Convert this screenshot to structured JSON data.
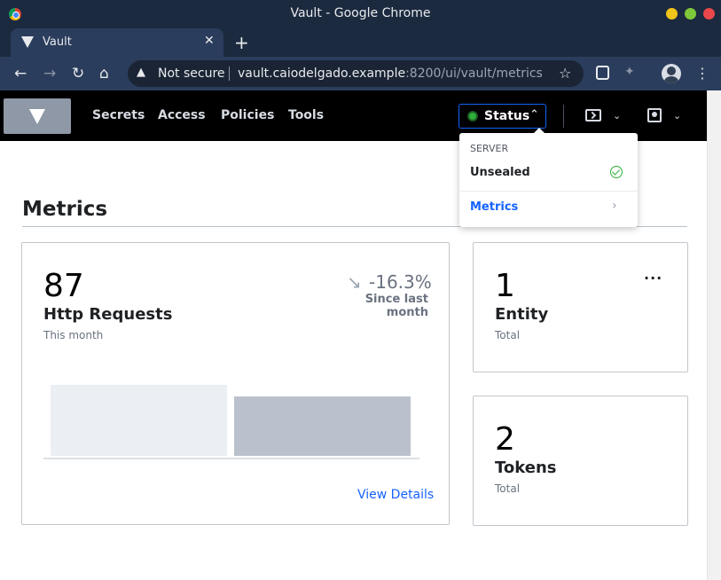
{
  "window": {
    "title": "Vault - Google Chrome"
  },
  "tab": {
    "title": "Vault",
    "close": "✕",
    "new_tab": "+"
  },
  "toolbar": {
    "security_text": "Not secure",
    "url_host": "vault.caiodelgado.example",
    "url_path": ":8200/ui/vault/metrics",
    "icons": [
      "back-icon",
      "forward-icon",
      "reload-icon",
      "home-icon",
      "warning-icon",
      "star-icon",
      "extension-icon",
      "profile-avatar",
      "menu-icon"
    ]
  },
  "nav": {
    "links": [
      "Secrets",
      "Access",
      "Policies",
      "Tools"
    ],
    "status_label": "Status",
    "status_color": "#2eb039",
    "accent_color": "#1563ff"
  },
  "dropdown": {
    "header": "SERVER",
    "unsealed": "Unsealed",
    "metrics": "Metrics"
  },
  "page": {
    "title": "Metrics"
  },
  "cards": {
    "http": {
      "value": "87",
      "label": "Http Requests",
      "sub": "This month",
      "delta": "-16.3%",
      "delta_label": "Since last month",
      "link": "View Details"
    },
    "entity": {
      "value": "1",
      "label": "Entity",
      "sub": "Total",
      "menu": "···"
    },
    "tokens": {
      "value": "2",
      "label": "Tokens",
      "sub": "Total"
    }
  },
  "chart_data": {
    "type": "bar",
    "categories": [
      "",
      ""
    ],
    "values": [
      104,
      87
    ],
    "colors": [
      "#ebeef2",
      "#bac1cc"
    ],
    "ylim": [
      0,
      104
    ]
  }
}
